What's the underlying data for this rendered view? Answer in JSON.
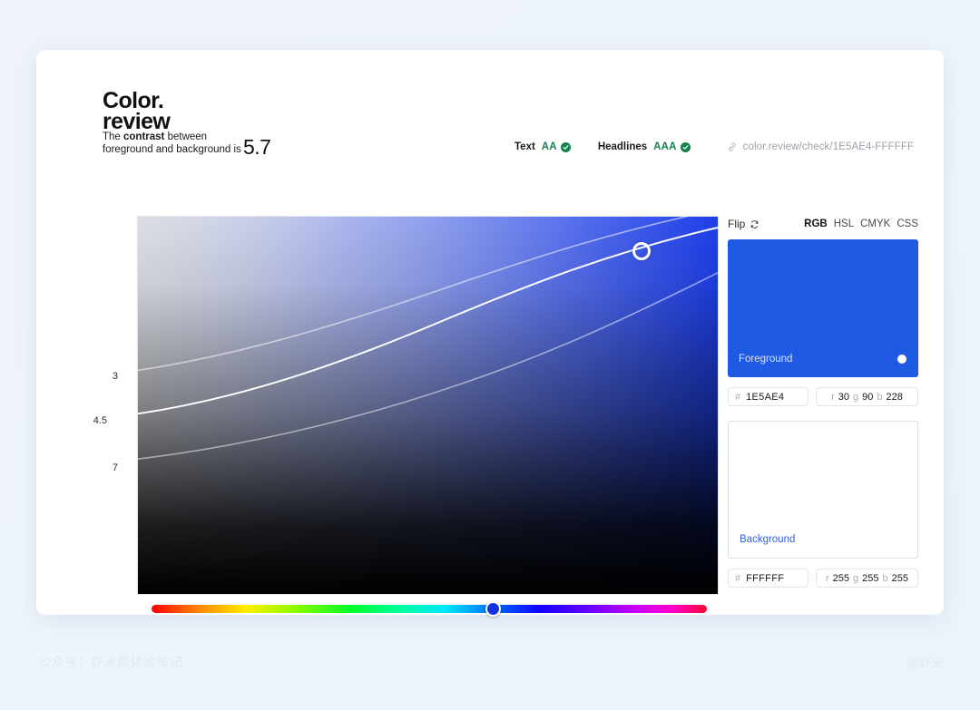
{
  "brand": {
    "line1": "Color.",
    "line2": "review"
  },
  "tagline": {
    "prefix": "The ",
    "bold": "contrast",
    "suffix": " between",
    "line2": "foreground and background is"
  },
  "contrast": {
    "ratio": "5.7"
  },
  "compliance": {
    "text_label": "Text",
    "text_level": "AA",
    "headlines_label": "Headlines",
    "headlines_level": "AAA",
    "pass_color": "#14804a",
    "url": "color.review/check/1E5AE4-FFFFFF",
    "link_icon": "link-icon",
    "check_icon": "check-circle-icon"
  },
  "canvas": {
    "axis_labels": [
      "3",
      "4.5",
      "7"
    ],
    "picker_icon": "picker-dot",
    "gradient_top_left": "#E8EAF4",
    "gradient_top_right": "#1E3FE8",
    "gradient_bottom": "#000000"
  },
  "hue_slider": {
    "name": "hue-slider",
    "knob_color": "#1231e0",
    "value_position_pct": 62
  },
  "panel": {
    "flip_label": "Flip",
    "flip_icon": "refresh-icon",
    "modes": [
      {
        "label": "RGB",
        "active": true
      },
      {
        "label": "HSL",
        "active": false
      },
      {
        "label": "CMYK",
        "active": false
      },
      {
        "label": "CSS",
        "active": false
      }
    ],
    "foreground": {
      "label": "Foreground",
      "color": "#1E5AE4",
      "hash": "#",
      "hex": "1E5AE4",
      "channels": [
        {
          "key": "r",
          "value": "30"
        },
        {
          "key": "g",
          "value": "90"
        },
        {
          "key": "b",
          "value": "228"
        }
      ]
    },
    "background": {
      "label": "Background",
      "color": "#FFFFFF",
      "hash": "#",
      "hex": "FFFFFF",
      "channels": [
        {
          "key": "r",
          "value": "255"
        },
        {
          "key": "g",
          "value": "255"
        },
        {
          "key": "b",
          "value": "255"
        }
      ]
    }
  },
  "watermarks": {
    "left": "公众号：虾米的体验笔记",
    "right": "@虾米"
  }
}
